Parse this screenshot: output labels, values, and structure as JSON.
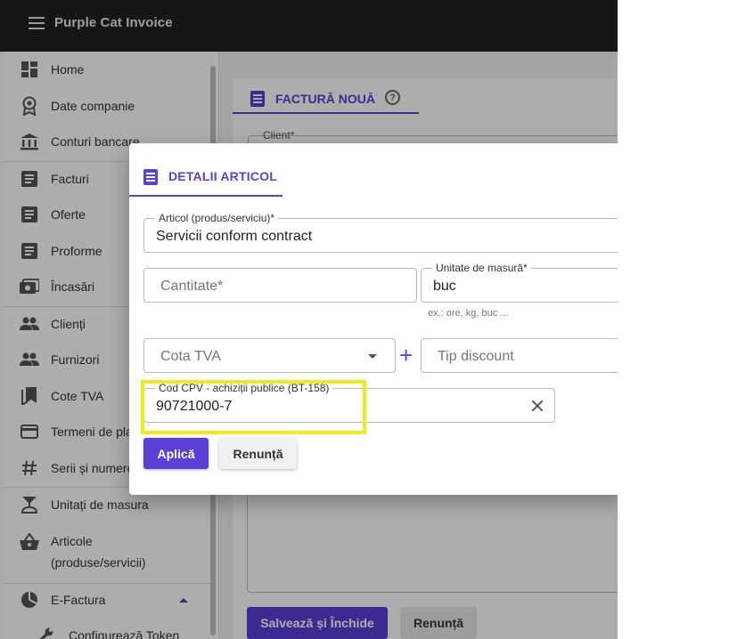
{
  "app": {
    "title": "Purple Cat Invoice"
  },
  "sidebar": {
    "items": [
      {
        "label": "Home",
        "icon": "dashboard-icon"
      },
      {
        "label": "Date companie",
        "icon": "award-icon"
      },
      {
        "label": "Conturi bancare",
        "icon": "bank-icon"
      },
      {
        "label": "Facturi",
        "icon": "document-icon"
      },
      {
        "label": "Oferte",
        "icon": "document-icon"
      },
      {
        "label": "Proforme",
        "icon": "document-icon"
      },
      {
        "label": "Încasări",
        "icon": "money-icon"
      },
      {
        "label": "Clienți",
        "icon": "people-icon"
      },
      {
        "label": "Furnizori",
        "icon": "people-icon"
      },
      {
        "label": "Cote TVA",
        "icon": "bookmark-icon"
      },
      {
        "label": "Termeni de pla",
        "icon": "credit-card-icon"
      },
      {
        "label": "Serii și numere",
        "icon": "hash-icon"
      },
      {
        "label": "Unitați de masura",
        "icon": "scale-icon"
      },
      {
        "label": "Articole",
        "label2": "(produse/servicii)",
        "icon": "basket-icon"
      },
      {
        "label": "E-Factura",
        "icon": "pie-chart-icon"
      },
      {
        "label": "Configurează Token",
        "icon": "wrench-icon"
      }
    ]
  },
  "main": {
    "tab_label": "FACTURĂ NOUĂ",
    "client_label": "Client*",
    "save_close_label": "Salvează și Închide",
    "cancel_label": "Renunță"
  },
  "dialog": {
    "tab_label": "DETALII ARTICOL",
    "article": {
      "label": "Articol (produs/serviciu)*",
      "value": "Servicii conform contract"
    },
    "quantity": {
      "placeholder": "Cantitate*"
    },
    "unit": {
      "label": "Unitate de masură*",
      "value": "buc",
      "hint": "ex.: ore, kg, buc ..."
    },
    "vat": {
      "placeholder": "Cota TVA"
    },
    "plus": "+",
    "discount": {
      "placeholder": "Tip discount"
    },
    "cpv": {
      "label": "Cod CPV - achiziții publice (BT-158)",
      "value": "90721000-7"
    },
    "apply_label": "Aplică",
    "cancel_label": "Renunță"
  },
  "colors": {
    "accent": "#5b3fd6",
    "highlight": "#f0ea1a",
    "topbar": "#212121"
  }
}
